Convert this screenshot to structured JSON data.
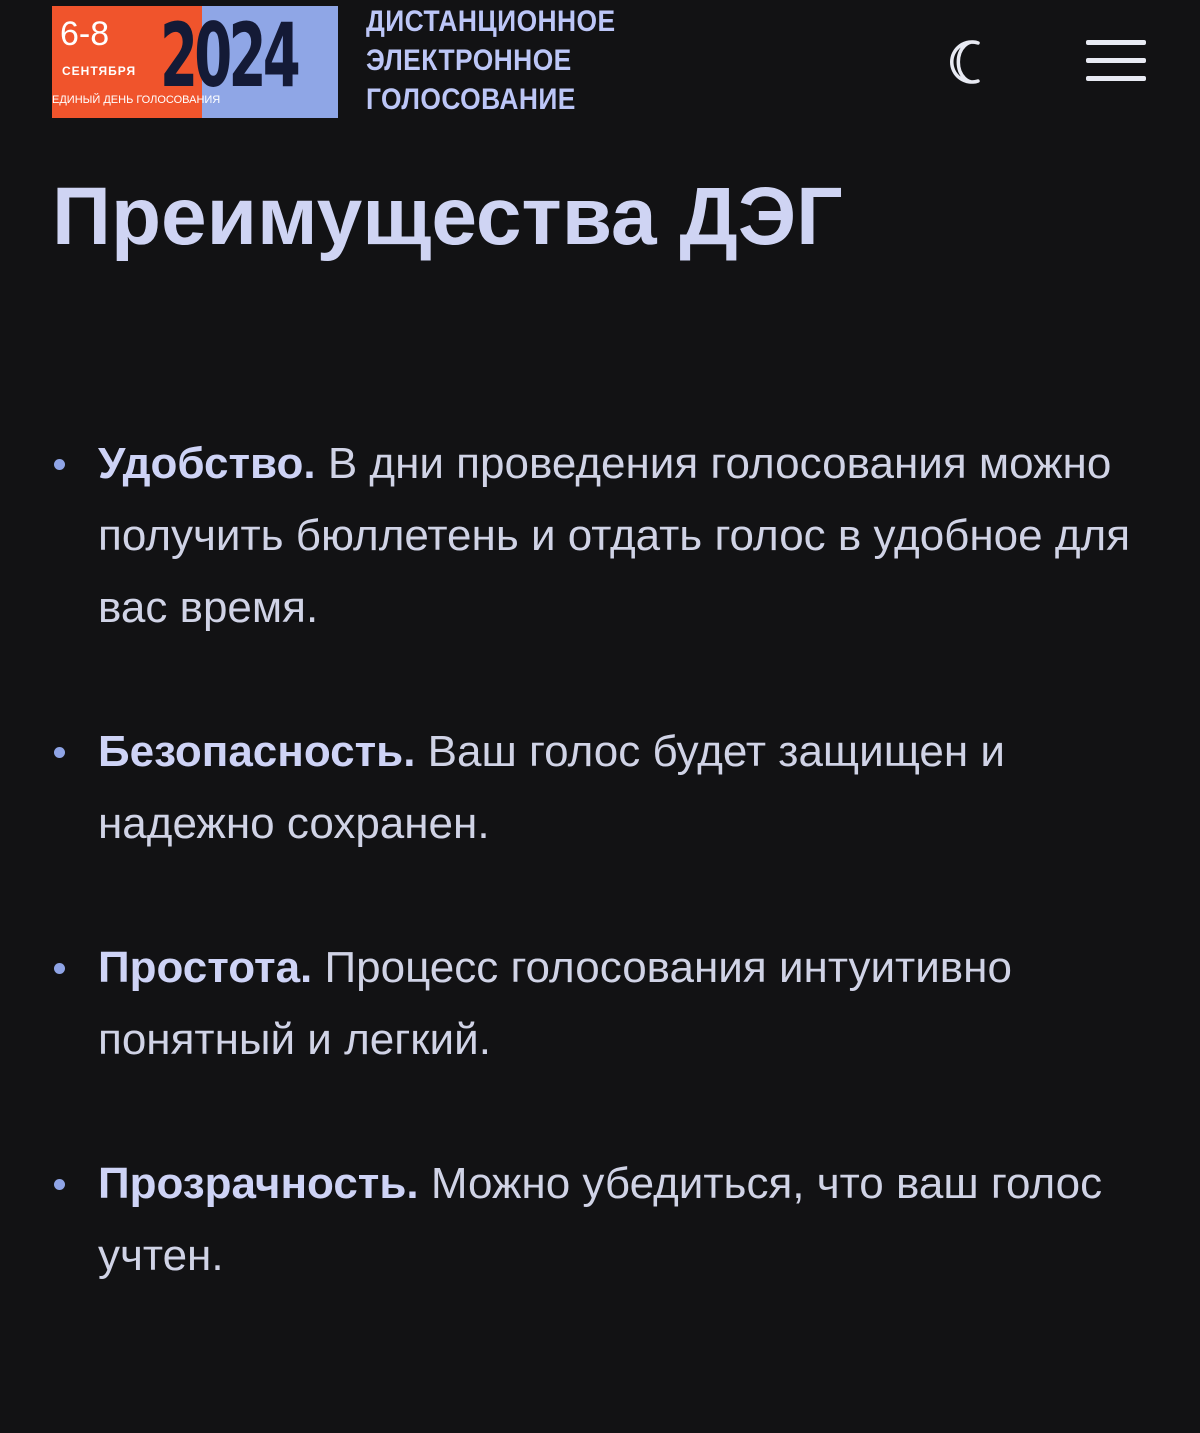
{
  "header": {
    "logo": {
      "dates": "6-8",
      "month": "СЕНТЯБРЯ",
      "year": "2024",
      "tagline": "ЕДИНЫЙ ДЕНЬ ГОЛОСОВАНИЯ",
      "colors": {
        "orange": "#f0542c",
        "blue": "#8fa6e6"
      }
    },
    "brand_lines": [
      "ДИСТАНЦИОННОЕ",
      "ЭЛЕКТРОННОЕ",
      "ГОЛОСОВАНИЕ"
    ],
    "theme_toggle_icon": "moon-icon",
    "menu_icon": "hamburger-menu-icon"
  },
  "main": {
    "title": "Преимущества ДЭГ",
    "benefits": [
      {
        "term": "Удобство.",
        "text": "В дни проведения голосования можно получить бюллетень и отдать голос в удобное для вас время."
      },
      {
        "term": "Безопасность.",
        "text": "Ваш голос будет защищен и надежно сохранен."
      },
      {
        "term": "Простота.",
        "text": "Процесс голосования интуитивно понятный и легкий."
      },
      {
        "term": "Прозрачность.",
        "text": "Можно убедиться, что ваш голос учтен."
      }
    ]
  },
  "theme": {
    "background": "#121214",
    "accent": "#8fa4e6",
    "text": "#d0d3e6"
  }
}
